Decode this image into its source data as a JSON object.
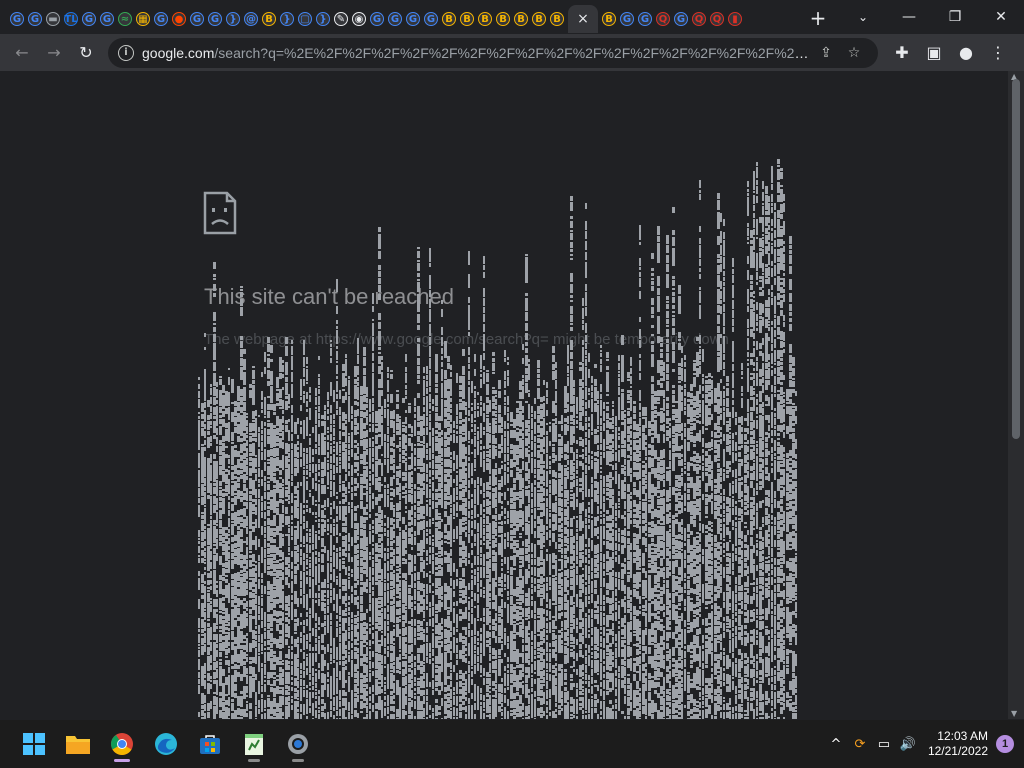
{
  "browser": {
    "tabs": [
      {
        "icon": "chrome-icon",
        "color": "#4285f4",
        "glyph": "G"
      },
      {
        "icon": "google-icon",
        "color": "#4285f4",
        "glyph": "G"
      },
      {
        "icon": "monitor-icon",
        "color": "#9aa0a6",
        "glyph": "▬"
      },
      {
        "icon": "tl-icon",
        "color": "#1a73e8",
        "glyph": "TL"
      },
      {
        "icon": "google-icon",
        "color": "#4285f4",
        "glyph": "G"
      },
      {
        "icon": "google-icon",
        "color": "#4285f4",
        "glyph": "G"
      },
      {
        "icon": "wave-icon",
        "color": "#34a853",
        "glyph": "≈"
      },
      {
        "icon": "app-icon",
        "color": "#f4b400",
        "glyph": "▦"
      },
      {
        "icon": "google-icon",
        "color": "#4285f4",
        "glyph": "G"
      },
      {
        "icon": "reddit-icon",
        "color": "#ff4500",
        "glyph": "●"
      },
      {
        "icon": "google-icon",
        "color": "#4285f4",
        "glyph": "G"
      },
      {
        "icon": "google-icon",
        "color": "#4285f4",
        "glyph": "G"
      },
      {
        "icon": "bracket-icon",
        "color": "#4285f4",
        "glyph": "}"
      },
      {
        "icon": "at-icon",
        "color": "#4285f4",
        "glyph": "@"
      },
      {
        "icon": "coin-icon",
        "color": "#f4b400",
        "glyph": "B"
      },
      {
        "icon": "bracket-icon",
        "color": "#4285f4",
        "glyph": "}"
      },
      {
        "icon": "chat-icon",
        "color": "#4285f4",
        "glyph": "▢"
      },
      {
        "icon": "bracket-icon",
        "color": "#4285f4",
        "glyph": "}"
      },
      {
        "icon": "puzzle-icon",
        "color": "#e8eaed",
        "glyph": "✎"
      },
      {
        "icon": "github-icon",
        "color": "#e8eaed",
        "glyph": "◉"
      },
      {
        "icon": "google-icon",
        "color": "#4285f4",
        "glyph": "G"
      },
      {
        "icon": "google-icon",
        "color": "#4285f4",
        "glyph": "G"
      },
      {
        "icon": "google-icon",
        "color": "#4285f4",
        "glyph": "G"
      },
      {
        "icon": "google-icon",
        "color": "#4285f4",
        "glyph": "G"
      },
      {
        "icon": "coin-icon",
        "color": "#f4b400",
        "glyph": "B"
      },
      {
        "icon": "coin-icon",
        "color": "#f4b400",
        "glyph": "B"
      },
      {
        "icon": "coin-icon",
        "color": "#f4b400",
        "glyph": "B"
      },
      {
        "icon": "coin-icon",
        "color": "#f4b400",
        "glyph": "B"
      },
      {
        "icon": "coin-icon",
        "color": "#f4b400",
        "glyph": "B"
      },
      {
        "icon": "coin-icon",
        "color": "#f4b400",
        "glyph": "B"
      },
      {
        "icon": "coin-icon",
        "color": "#f4b400",
        "glyph": "B"
      },
      {
        "icon": "close-icon",
        "color": "#e8eaed",
        "glyph": "×",
        "active": true
      },
      {
        "icon": "coin-icon",
        "color": "#f4b400",
        "glyph": "B"
      },
      {
        "icon": "google-icon",
        "color": "#4285f4",
        "glyph": "G"
      },
      {
        "icon": "google-icon",
        "color": "#4285f4",
        "glyph": "G"
      },
      {
        "icon": "q-icon",
        "color": "#d93025",
        "glyph": "Q"
      },
      {
        "icon": "google-icon",
        "color": "#4285f4",
        "glyph": "G"
      },
      {
        "icon": "q-icon",
        "color": "#d93025",
        "glyph": "Q"
      },
      {
        "icon": "q-icon",
        "color": "#d93025",
        "glyph": "Q"
      },
      {
        "icon": "battery-icon",
        "color": "#d93025",
        "glyph": "▮"
      }
    ],
    "new_tab_label": "+",
    "tab_search_label": "⌄",
    "window_controls": {
      "minimize": "—",
      "restore": "❐",
      "close": "✕"
    },
    "toolbar": {
      "back": "←",
      "forward": "→",
      "reload": "↻",
      "url_domain": "google.com",
      "url_rest": "/search?q=%2E%2F%2F%2F%2F%2F%2F%2F%2F%2F%2F%2F%2F%2F%2F%2F%2F%2F%2F%2F%2F%2F%2F%2F%2F%2F%2F%2F%2F...",
      "share": "⇪",
      "bookmark": "☆",
      "extensions": "✚",
      "sidepanel": "▣",
      "profile": "●",
      "menu": "⋮"
    }
  },
  "page": {
    "error_title": "This site can't be reached",
    "error_subtitle": "The webpage at https://www.google.com/search?q= might be temporarily down"
  },
  "taskbar": {
    "apps": [
      {
        "name": "start-button",
        "glyph": "start",
        "color": "#4cc2ff"
      },
      {
        "name": "file-explorer-icon",
        "glyph": "folder",
        "color": "#f8c434"
      },
      {
        "name": "chrome-taskbar-icon",
        "glyph": "chrome",
        "color": "#4285f4",
        "active": true
      },
      {
        "name": "edge-icon",
        "glyph": "edge",
        "color": "#2bb6d8"
      },
      {
        "name": "store-icon",
        "glyph": "store",
        "color": "#2ea0f0"
      },
      {
        "name": "notepad-icon",
        "glyph": "notepad",
        "color": "#7fd07f"
      },
      {
        "name": "settings-icon",
        "glyph": "gear",
        "color": "#9aa0a6"
      }
    ],
    "tray": {
      "chevron": "^",
      "sync": "⟳",
      "network": "▭",
      "volume": "🔊",
      "time": "12:03 AM",
      "date": "12/21/2022",
      "notifications": "1"
    }
  }
}
